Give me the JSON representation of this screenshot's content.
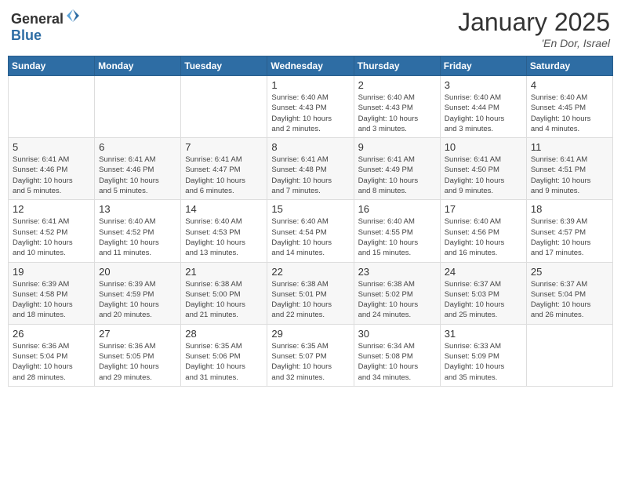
{
  "header": {
    "logo_general": "General",
    "logo_blue": "Blue",
    "month_year": "January 2025",
    "location": "'En Dor, Israel"
  },
  "weekdays": [
    "Sunday",
    "Monday",
    "Tuesday",
    "Wednesday",
    "Thursday",
    "Friday",
    "Saturday"
  ],
  "weeks": [
    [
      {
        "day": "",
        "info": ""
      },
      {
        "day": "",
        "info": ""
      },
      {
        "day": "",
        "info": ""
      },
      {
        "day": "1",
        "info": "Sunrise: 6:40 AM\nSunset: 4:43 PM\nDaylight: 10 hours\nand 2 minutes."
      },
      {
        "day": "2",
        "info": "Sunrise: 6:40 AM\nSunset: 4:43 PM\nDaylight: 10 hours\nand 3 minutes."
      },
      {
        "day": "3",
        "info": "Sunrise: 6:40 AM\nSunset: 4:44 PM\nDaylight: 10 hours\nand 3 minutes."
      },
      {
        "day": "4",
        "info": "Sunrise: 6:40 AM\nSunset: 4:45 PM\nDaylight: 10 hours\nand 4 minutes."
      }
    ],
    [
      {
        "day": "5",
        "info": "Sunrise: 6:41 AM\nSunset: 4:46 PM\nDaylight: 10 hours\nand 5 minutes."
      },
      {
        "day": "6",
        "info": "Sunrise: 6:41 AM\nSunset: 4:46 PM\nDaylight: 10 hours\nand 5 minutes."
      },
      {
        "day": "7",
        "info": "Sunrise: 6:41 AM\nSunset: 4:47 PM\nDaylight: 10 hours\nand 6 minutes."
      },
      {
        "day": "8",
        "info": "Sunrise: 6:41 AM\nSunset: 4:48 PM\nDaylight: 10 hours\nand 7 minutes."
      },
      {
        "day": "9",
        "info": "Sunrise: 6:41 AM\nSunset: 4:49 PM\nDaylight: 10 hours\nand 8 minutes."
      },
      {
        "day": "10",
        "info": "Sunrise: 6:41 AM\nSunset: 4:50 PM\nDaylight: 10 hours\nand 9 minutes."
      },
      {
        "day": "11",
        "info": "Sunrise: 6:41 AM\nSunset: 4:51 PM\nDaylight: 10 hours\nand 9 minutes."
      }
    ],
    [
      {
        "day": "12",
        "info": "Sunrise: 6:41 AM\nSunset: 4:52 PM\nDaylight: 10 hours\nand 10 minutes."
      },
      {
        "day": "13",
        "info": "Sunrise: 6:40 AM\nSunset: 4:52 PM\nDaylight: 10 hours\nand 11 minutes."
      },
      {
        "day": "14",
        "info": "Sunrise: 6:40 AM\nSunset: 4:53 PM\nDaylight: 10 hours\nand 13 minutes."
      },
      {
        "day": "15",
        "info": "Sunrise: 6:40 AM\nSunset: 4:54 PM\nDaylight: 10 hours\nand 14 minutes."
      },
      {
        "day": "16",
        "info": "Sunrise: 6:40 AM\nSunset: 4:55 PM\nDaylight: 10 hours\nand 15 minutes."
      },
      {
        "day": "17",
        "info": "Sunrise: 6:40 AM\nSunset: 4:56 PM\nDaylight: 10 hours\nand 16 minutes."
      },
      {
        "day": "18",
        "info": "Sunrise: 6:39 AM\nSunset: 4:57 PM\nDaylight: 10 hours\nand 17 minutes."
      }
    ],
    [
      {
        "day": "19",
        "info": "Sunrise: 6:39 AM\nSunset: 4:58 PM\nDaylight: 10 hours\nand 18 minutes."
      },
      {
        "day": "20",
        "info": "Sunrise: 6:39 AM\nSunset: 4:59 PM\nDaylight: 10 hours\nand 20 minutes."
      },
      {
        "day": "21",
        "info": "Sunrise: 6:38 AM\nSunset: 5:00 PM\nDaylight: 10 hours\nand 21 minutes."
      },
      {
        "day": "22",
        "info": "Sunrise: 6:38 AM\nSunset: 5:01 PM\nDaylight: 10 hours\nand 22 minutes."
      },
      {
        "day": "23",
        "info": "Sunrise: 6:38 AM\nSunset: 5:02 PM\nDaylight: 10 hours\nand 24 minutes."
      },
      {
        "day": "24",
        "info": "Sunrise: 6:37 AM\nSunset: 5:03 PM\nDaylight: 10 hours\nand 25 minutes."
      },
      {
        "day": "25",
        "info": "Sunrise: 6:37 AM\nSunset: 5:04 PM\nDaylight: 10 hours\nand 26 minutes."
      }
    ],
    [
      {
        "day": "26",
        "info": "Sunrise: 6:36 AM\nSunset: 5:04 PM\nDaylight: 10 hours\nand 28 minutes."
      },
      {
        "day": "27",
        "info": "Sunrise: 6:36 AM\nSunset: 5:05 PM\nDaylight: 10 hours\nand 29 minutes."
      },
      {
        "day": "28",
        "info": "Sunrise: 6:35 AM\nSunset: 5:06 PM\nDaylight: 10 hours\nand 31 minutes."
      },
      {
        "day": "29",
        "info": "Sunrise: 6:35 AM\nSunset: 5:07 PM\nDaylight: 10 hours\nand 32 minutes."
      },
      {
        "day": "30",
        "info": "Sunrise: 6:34 AM\nSunset: 5:08 PM\nDaylight: 10 hours\nand 34 minutes."
      },
      {
        "day": "31",
        "info": "Sunrise: 6:33 AM\nSunset: 5:09 PM\nDaylight: 10 hours\nand 35 minutes."
      },
      {
        "day": "",
        "info": ""
      }
    ]
  ]
}
